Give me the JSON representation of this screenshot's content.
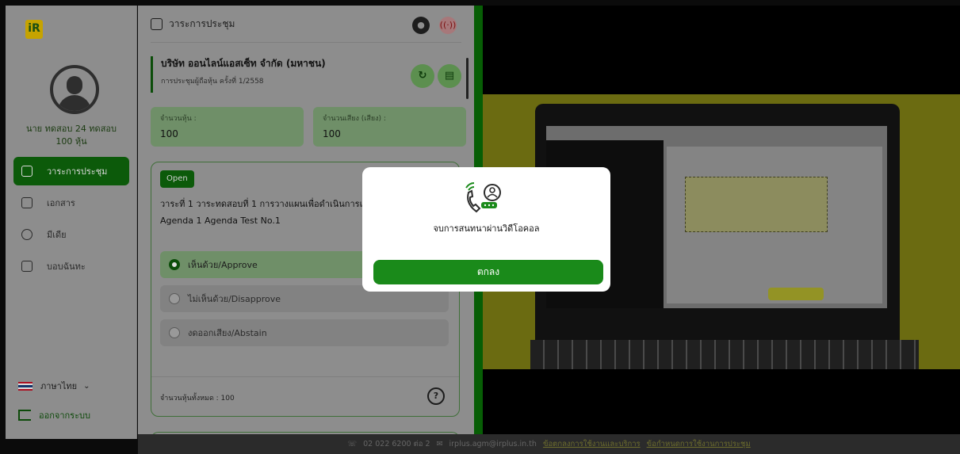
{
  "sidebar": {
    "logo_text": "iR",
    "user_name": "นาย ทดสอบ 24 ทดสอบ",
    "user_shares": "100 หุ้น",
    "nav": [
      {
        "label": "วาระการประชุม",
        "icon": "agenda-icon"
      },
      {
        "label": "เอกสาร",
        "icon": "folder-icon"
      },
      {
        "label": "มีเดีย",
        "icon": "media-icon"
      },
      {
        "label": "บอบฉันทะ",
        "icon": "proxy-icon"
      }
    ],
    "language": "ภาษาไทย",
    "logout": "ออกจากระบบ"
  },
  "main": {
    "header_title": "วาระการประชุม",
    "company_name": "บริษัท ออนไลน์แอสเซ็ท จำกัด (มหาชน)",
    "meeting_name": "การประชุมผู้ถือหุ้น ครั้งที่ 1/2558",
    "shares_label": "จำนวนหุ้น :",
    "shares_value": "100",
    "votes_label": "จำนวนเสียง (เสียง) :",
    "votes_value": "100",
    "status_badge": "Open",
    "agenda_th": "วาระที่ 1 วาระทดสอบที่ 1 การวางแผนเพื่อดำเนินการแก้ไ",
    "agenda_en": "Agenda 1 Agenda Test No.1",
    "options": [
      "เห็นด้วย/Approve",
      "ไม่เห็นด้วย/Disapprove",
      "งดออกเสียง/Abstain"
    ],
    "total_shares": "จำนวนหุ้นทั้งหมด : 100",
    "help_label": "?"
  },
  "modal": {
    "message": "จบการสนทนาผ่านวิดีโอคอล",
    "ok_label": "ตกลง"
  },
  "footer": {
    "phone": "02 022 6200 ต่อ 2",
    "email": "irplus.agm@irplus.in.th",
    "terms": "ข้อตกลงการใช้งานและบริการ",
    "rules": "ข้อกำหนดการใช้งานการประชุม"
  },
  "colors": {
    "accent": "#1a8a1a",
    "dark_green": "#075e05"
  }
}
